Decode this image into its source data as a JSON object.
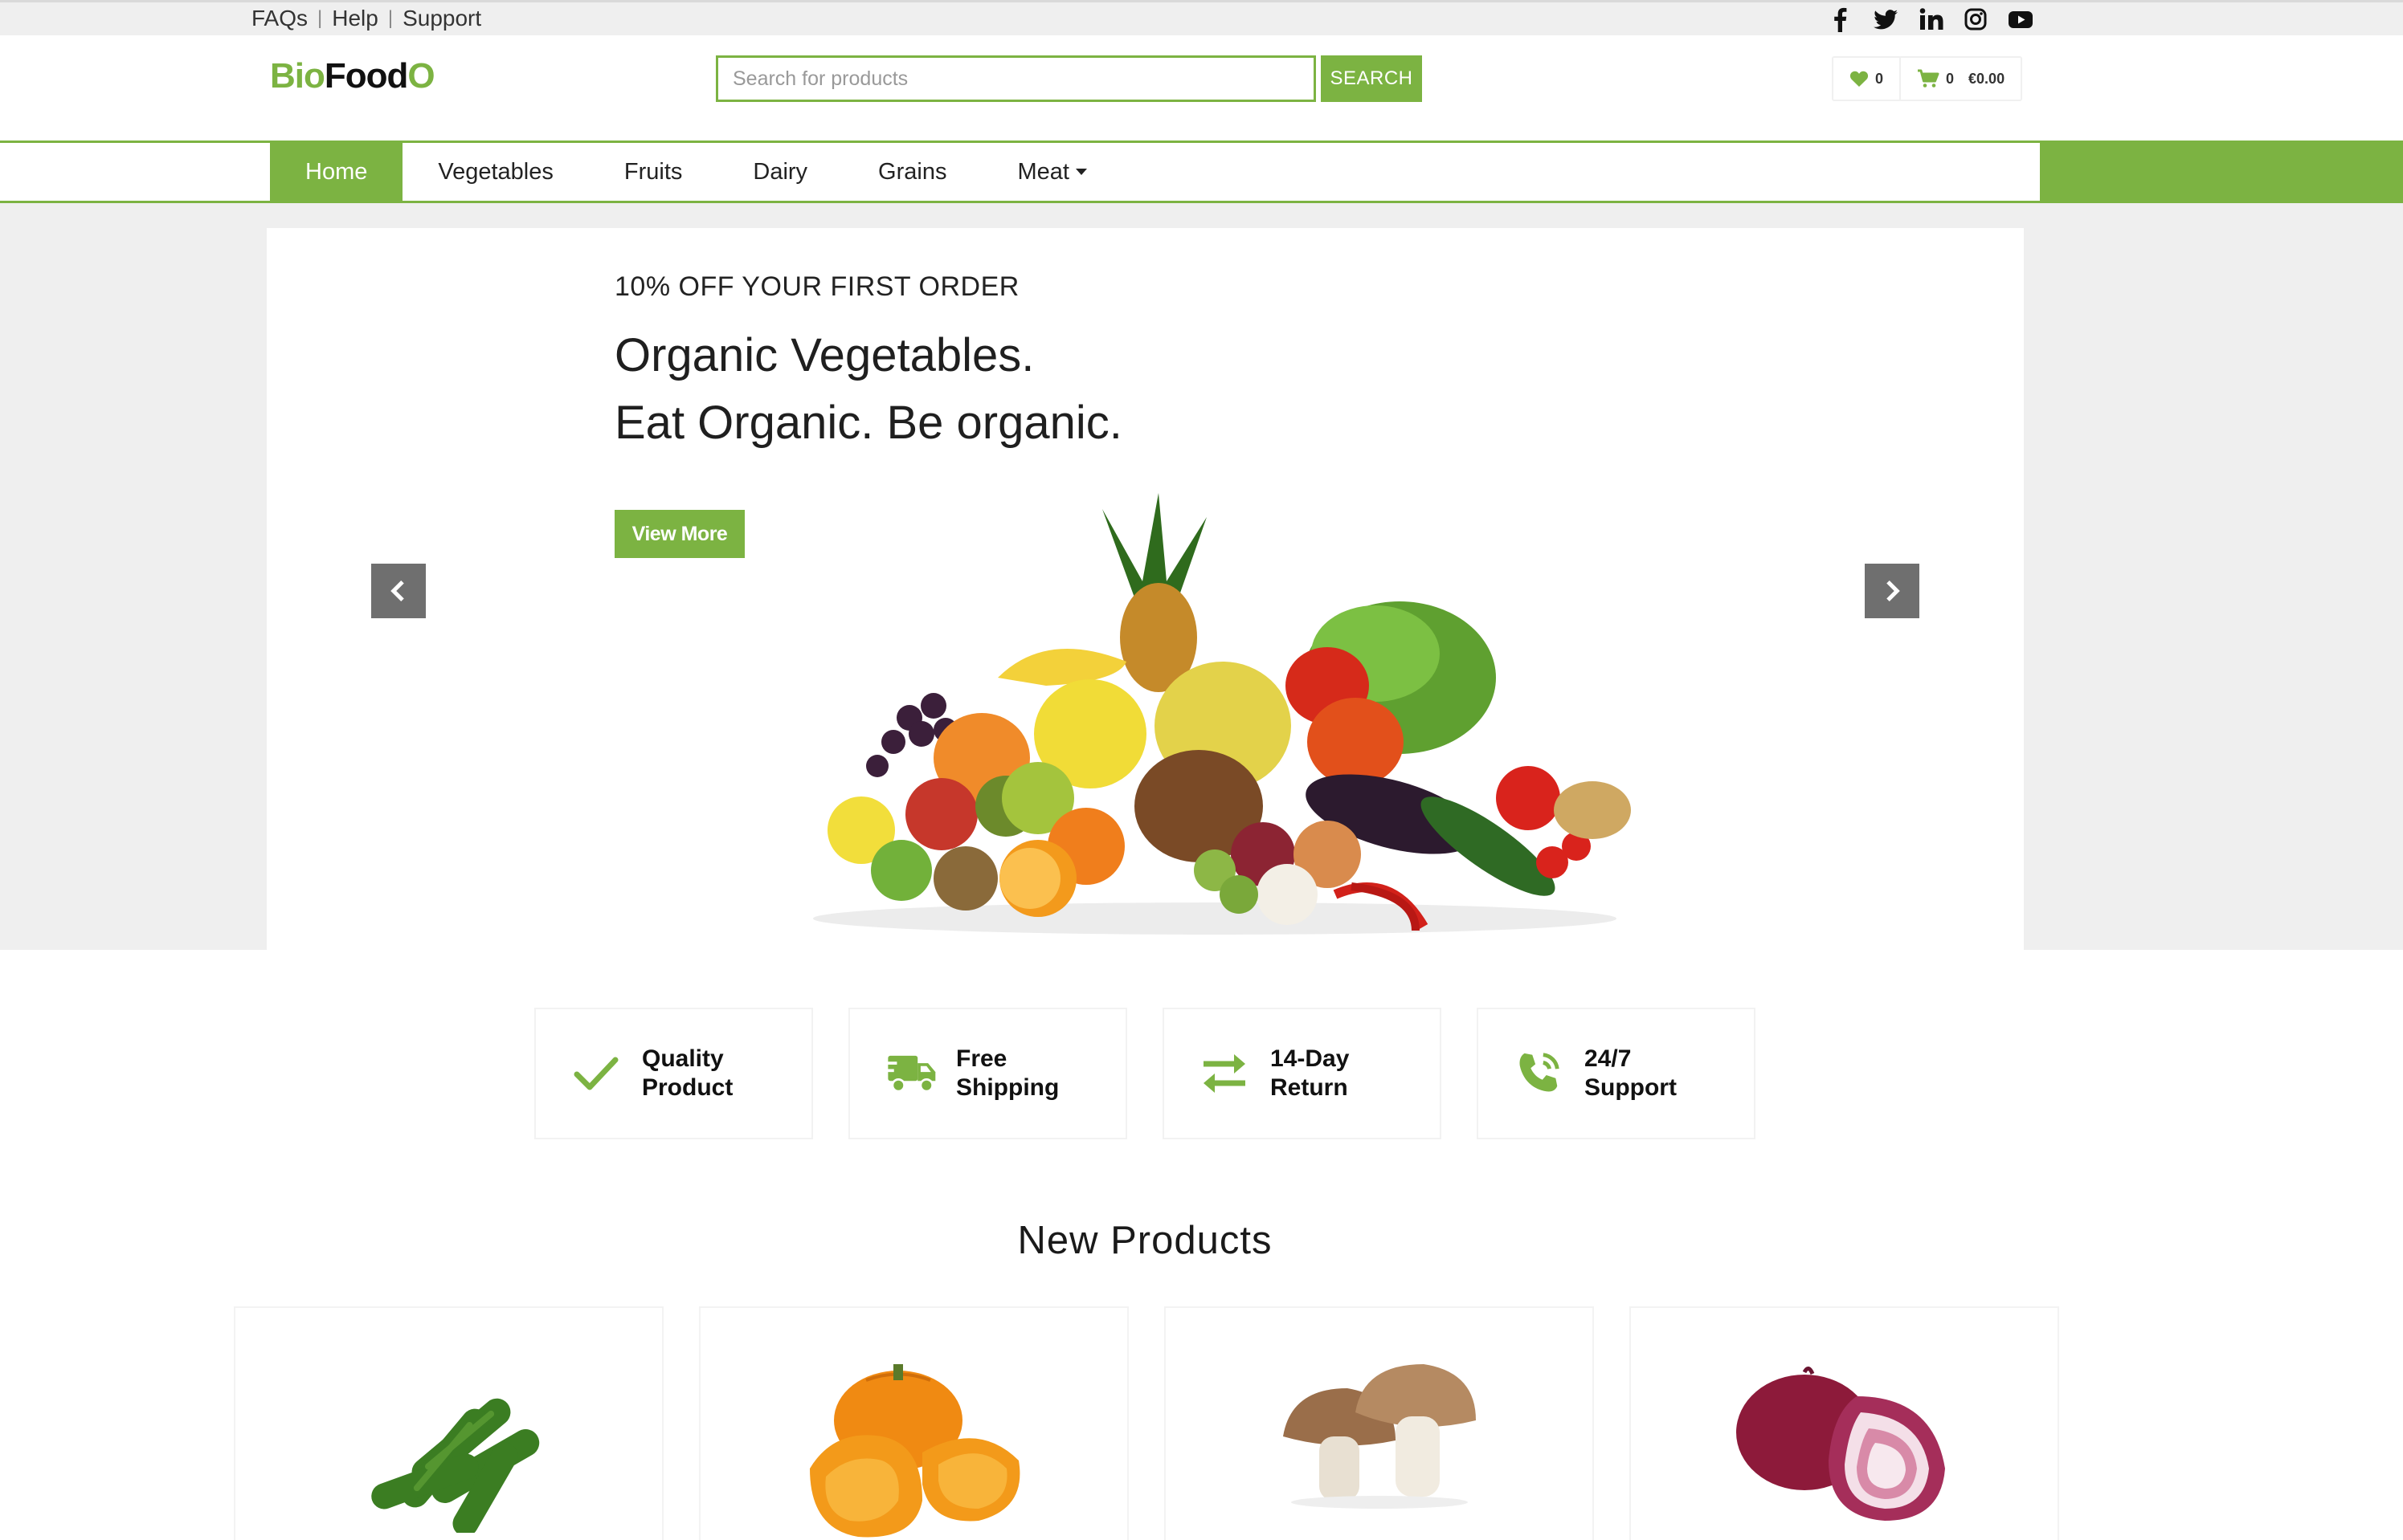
{
  "topbar": {
    "links": [
      "FAQs",
      "Help",
      "Support"
    ],
    "social_icons": [
      "facebook-icon",
      "twitter-icon",
      "linkedin-icon",
      "instagram-icon",
      "youtube-icon"
    ]
  },
  "header": {
    "logo_part1": "Bio",
    "logo_part2": "Food",
    "logo_part3": "O",
    "search_placeholder": "Search for products",
    "search_button": "SEARCH",
    "wishlist_count": "0",
    "cart_count": "0",
    "cart_total": "€0.00"
  },
  "nav": {
    "items": [
      "Home",
      "Vegetables",
      "Fruits",
      "Dairy",
      "Grains",
      "Meat"
    ],
    "active": "Home"
  },
  "hero": {
    "promo": "10% OFF YOUR FIRST ORDER",
    "headline_line1": "Organic Vegetables.",
    "headline_line2": "Eat Organic. Be organic.",
    "cta": "View More"
  },
  "features": [
    {
      "line1": "Quality",
      "line2": "Product",
      "icon": "check-icon"
    },
    {
      "line1": "Free",
      "line2": "Shipping",
      "icon": "truck-icon"
    },
    {
      "line1": "14-Day",
      "line2": "Return",
      "icon": "exchange-arrows-icon"
    },
    {
      "line1": "24/7",
      "line2": "Support",
      "icon": "phone-icon"
    }
  ],
  "new_products": {
    "title": "New Products",
    "items": [
      "cucumber-image",
      "pumpkin-image",
      "mushroom-image",
      "onion-image"
    ]
  },
  "colors": {
    "accent": "#7cb342",
    "topbar_bg": "#efefef",
    "hero_bg": "#efefef",
    "arrow_bg": "#6f6f6f"
  }
}
